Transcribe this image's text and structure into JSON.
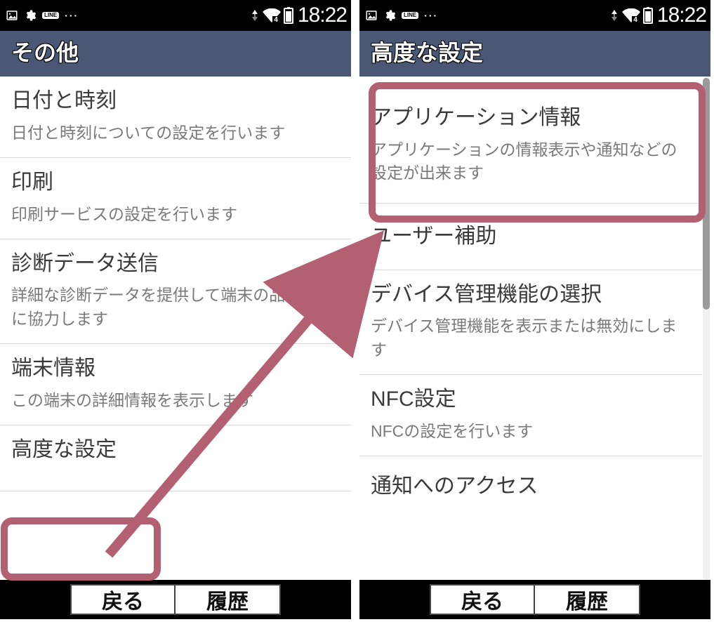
{
  "status": {
    "time": "18:22",
    "wifi_badge": "4"
  },
  "left": {
    "title": "その他",
    "items": [
      {
        "title": "日付と時刻",
        "desc": "日付と時刻についての設定を行います"
      },
      {
        "title": "印刷",
        "desc": "印刷サービスの設定を行います"
      },
      {
        "title": "診断データ送信",
        "desc": "詳細な診断データを提供して端末の品質改善に協力します"
      },
      {
        "title": "端末情報",
        "desc": "この端末の詳細情報を表示します"
      },
      {
        "title": "高度な設定",
        "desc": ""
      }
    ],
    "buttons": {
      "back": "戻る",
      "history": "履歴"
    }
  },
  "right": {
    "title": "高度な設定",
    "items": [
      {
        "title": "アプリケーション情報",
        "desc": "アプリケーションの情報表示や通知などの設定が出来ます"
      },
      {
        "title": "ユーザー補助",
        "desc": ""
      },
      {
        "title": "デバイス管理機能の選択",
        "desc": "デバイス管理機能を表示または無効にします"
      },
      {
        "title": "NFC設定",
        "desc": "NFCの設定を行います"
      },
      {
        "title": "通知へのアクセス",
        "desc": ""
      }
    ],
    "buttons": {
      "back": "戻る",
      "history": "履歴"
    }
  }
}
